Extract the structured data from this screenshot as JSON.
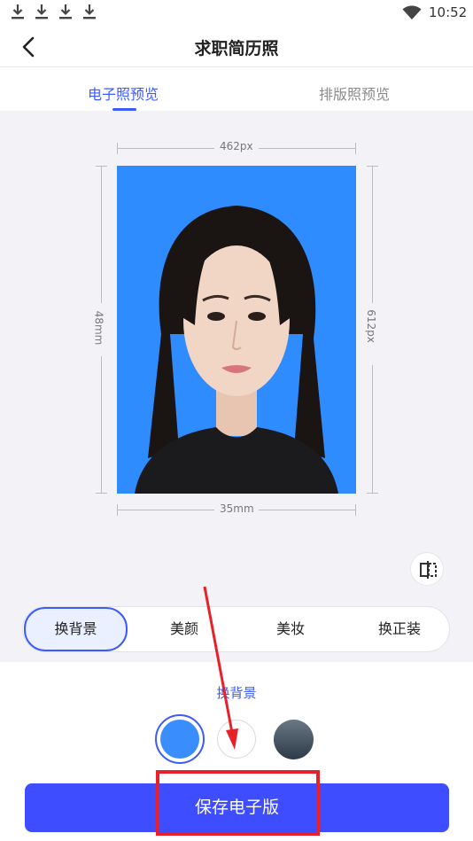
{
  "status": {
    "time": "10:52"
  },
  "header": {
    "title": "求职简历照"
  },
  "tabs": [
    {
      "label": "电子照预览"
    },
    {
      "label": "排版照预览"
    }
  ],
  "preview": {
    "width_px_label": "462px",
    "height_px_label": "612px",
    "width_mm_label": "35mm",
    "height_mm_label": "48mm"
  },
  "segments": [
    {
      "label": "换背景"
    },
    {
      "label": "美颜"
    },
    {
      "label": "美妆"
    },
    {
      "label": "换正装"
    }
  ],
  "panel": {
    "label": "换背景"
  },
  "background_colors": [
    "#3a8dfd",
    "#ffffff",
    "#3f4d5b"
  ],
  "save_button": {
    "label": "保存电子版"
  },
  "colors": {
    "accent": "#3d5afe",
    "button": "#3d4dff",
    "annotation": "#e8202a"
  }
}
